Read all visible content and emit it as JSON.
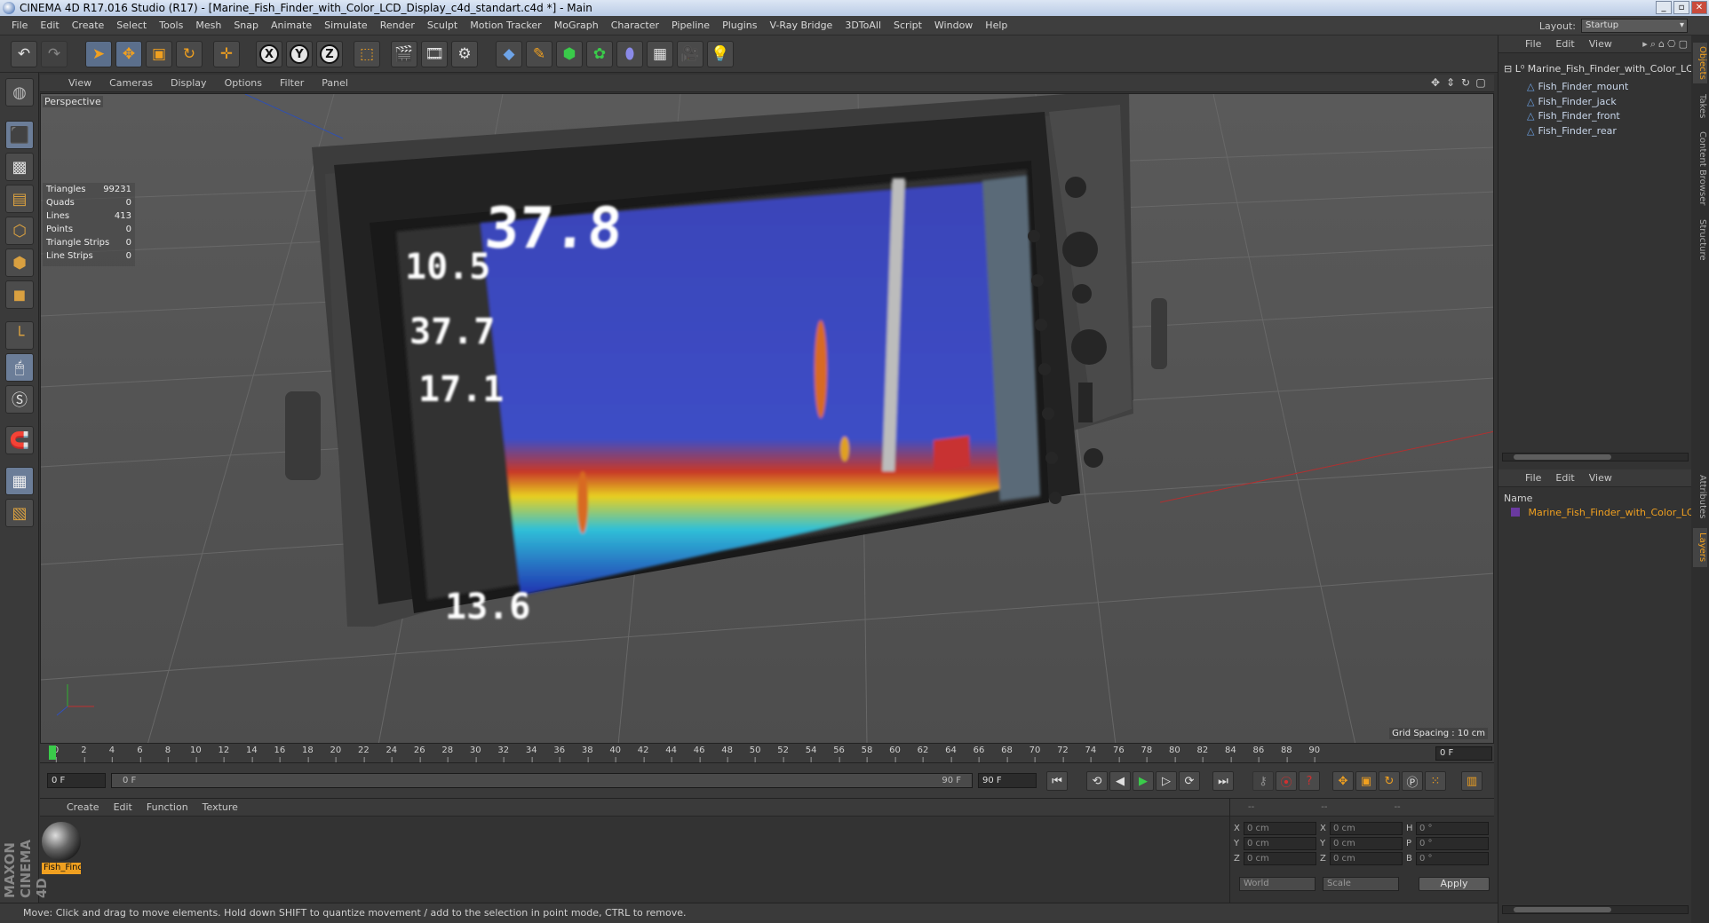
{
  "window": {
    "title": "CINEMA 4D R17.016 Studio (R17) - [Marine_Fish_Finder_with_Color_LCD_Display_c4d_standart.c4d *] - Main",
    "buttons": [
      "_",
      "▫",
      "✕"
    ]
  },
  "menubar": {
    "items": [
      "File",
      "Edit",
      "Create",
      "Select",
      "Tools",
      "Mesh",
      "Snap",
      "Animate",
      "Simulate",
      "Render",
      "Sculpt",
      "Motion Tracker",
      "MoGraph",
      "Character",
      "Pipeline",
      "Plugins",
      "V-Ray Bridge",
      "3DToAll",
      "Script",
      "Window",
      "Help"
    ],
    "layout_label": "Layout:",
    "layout_value": "Startup"
  },
  "viewport": {
    "menu": [
      "View",
      "Cameras",
      "Display",
      "Options",
      "Filter",
      "Panel"
    ],
    "camera_label": "Perspective",
    "stats": [
      {
        "label": "Triangles",
        "value": "99231"
      },
      {
        "label": "Quads",
        "value": "0"
      },
      {
        "label": "Lines",
        "value": "413"
      },
      {
        "label": "Points",
        "value": "0"
      },
      {
        "label": "Triangle Strips",
        "value": "0"
      },
      {
        "label": "Line Strips",
        "value": "0"
      }
    ],
    "grid_spacing": "Grid Spacing : 10 cm",
    "screen_readouts": [
      "37.8",
      "10.5",
      "37.7",
      "17.1",
      "13.6"
    ]
  },
  "timeline": {
    "ticks": [
      "0",
      "2",
      "4",
      "6",
      "8",
      "10",
      "12",
      "14",
      "16",
      "18",
      "20",
      "22",
      "24",
      "26",
      "28",
      "30",
      "32",
      "34",
      "36",
      "38",
      "40",
      "42",
      "44",
      "46",
      "48",
      "50",
      "52",
      "54",
      "56",
      "58",
      "60",
      "62",
      "64",
      "66",
      "68",
      "70",
      "72",
      "74",
      "76",
      "78",
      "80",
      "82",
      "84",
      "86",
      "88",
      "90"
    ],
    "current_frame": "0 F"
  },
  "transport": {
    "start_field": "0 F",
    "slider_left": "0 F",
    "slider_right": "90 F",
    "end_field": "90 F"
  },
  "materials": {
    "menu": [
      "Create",
      "Edit",
      "Function",
      "Texture"
    ],
    "material_name": "Fish_Finder"
  },
  "coordinates": {
    "header": [
      "--",
      "--",
      "--"
    ],
    "rows": [
      [
        {
          "ax": "X",
          "val": "0 cm"
        },
        {
          "ax": "X",
          "val": "0 cm"
        },
        {
          "ax": "H",
          "val": "0 °"
        }
      ],
      [
        {
          "ax": "Y",
          "val": "0 cm"
        },
        {
          "ax": "Y",
          "val": "0 cm"
        },
        {
          "ax": "P",
          "val": "0 °"
        }
      ],
      [
        {
          "ax": "Z",
          "val": "0 cm"
        },
        {
          "ax": "Z",
          "val": "0 cm"
        },
        {
          "ax": "B",
          "val": "0 °"
        }
      ]
    ],
    "mode_world": "World",
    "mode_scale": "Scale",
    "apply": "Apply"
  },
  "objects": {
    "menu": [
      "File",
      "Edit",
      "View"
    ],
    "root": "Marine_Fish_Finder_with_Color_LCD_Display",
    "children": [
      "Fish_Finder_mount",
      "Fish_Finder_jack",
      "Fish_Finder_front",
      "Fish_Finder_rear"
    ]
  },
  "layers": {
    "menu": [
      "File",
      "Edit",
      "View"
    ],
    "column": "Name",
    "item": "Marine_Fish_Finder_with_Color_LCD_Display"
  },
  "side_tabs": [
    "Objects",
    "Takes",
    "Content Browser",
    "Structure",
    "Attributes",
    "Layers"
  ],
  "statusbar": {
    "text": "Move: Click and drag to move elements. Hold down SHIFT to quantize movement / add to the selection in point mode, CTRL to remove."
  },
  "logo": "MAXON CINEMA 4D"
}
